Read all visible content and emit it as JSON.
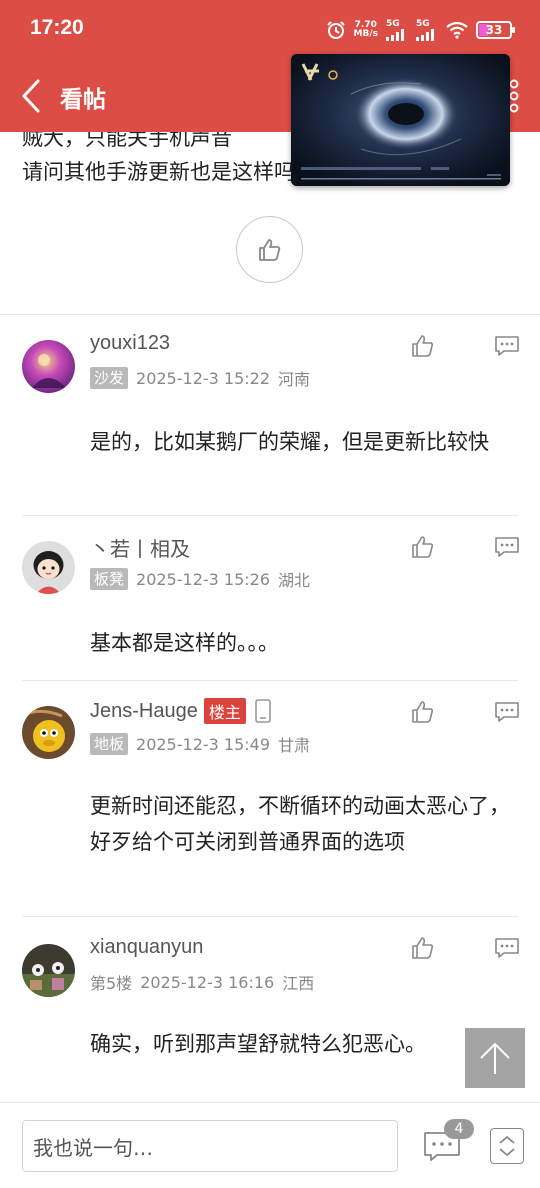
{
  "status": {
    "time": "17:20",
    "speed_value": "7.70",
    "speed_unit": "MB/s",
    "sig1": "5G",
    "sig2": "5G",
    "battery": "33"
  },
  "header": {
    "title": "看帖"
  },
  "post_tail": {
    "line1": "贼大，只能关手机声音",
    "line2": "请问其他手游更新也是这样吗"
  },
  "comments": [
    {
      "name": "youxi123",
      "floor": "沙发",
      "time": "2025-12-3 15:22",
      "location": "河南",
      "body": "是的，比如某鹅厂的荣耀，但是更新比较快"
    },
    {
      "name": "丶若丨相及",
      "floor": "板凳",
      "time": "2025-12-3 15:26",
      "location": "湖北",
      "body": "基本都是这样的。。。"
    },
    {
      "name": "Jens-Hauge",
      "host_badge": "楼主",
      "floor": "地板",
      "time": "2025-12-3 15:49",
      "location": "甘肃",
      "body": "更新时间还能忍，不断循环的动画太恶心了，好歹给个可关闭到普通界面的选项"
    },
    {
      "name": "xianquanyun",
      "floor": "第5楼",
      "time": "2025-12-3 16:16",
      "location": "江西",
      "body": "确实，听到那声望舒就特么犯恶心。"
    }
  ],
  "bottom": {
    "input_placeholder": "我也说一句…",
    "comment_count": "4"
  },
  "colors": {
    "brand_red": "#dc4e45",
    "host_badge": "#d9453c"
  }
}
